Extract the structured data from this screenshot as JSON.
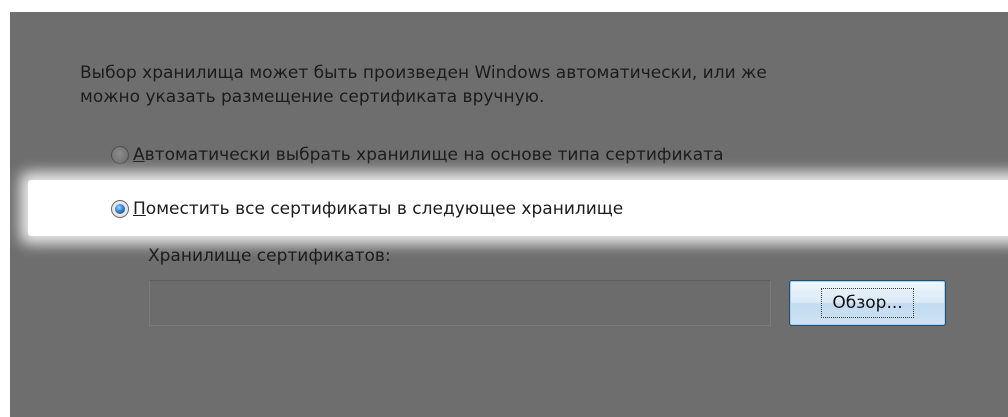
{
  "description": {
    "line1": "Выбор хранилища может быть произведен Windows автоматически, или же",
    "line2": "можно указать размещение сертификата вручную."
  },
  "radio_auto": {
    "accel": "А",
    "rest": "втоматически выбрать хранилище на основе типа сертификата",
    "checked": false
  },
  "radio_manual": {
    "accel": "П",
    "rest": "оместить все сертификаты в следующее хранилище",
    "checked": true
  },
  "store": {
    "label": "Хранилище сертификатов:",
    "value": ""
  },
  "browse_button": {
    "label": "Обзор..."
  }
}
